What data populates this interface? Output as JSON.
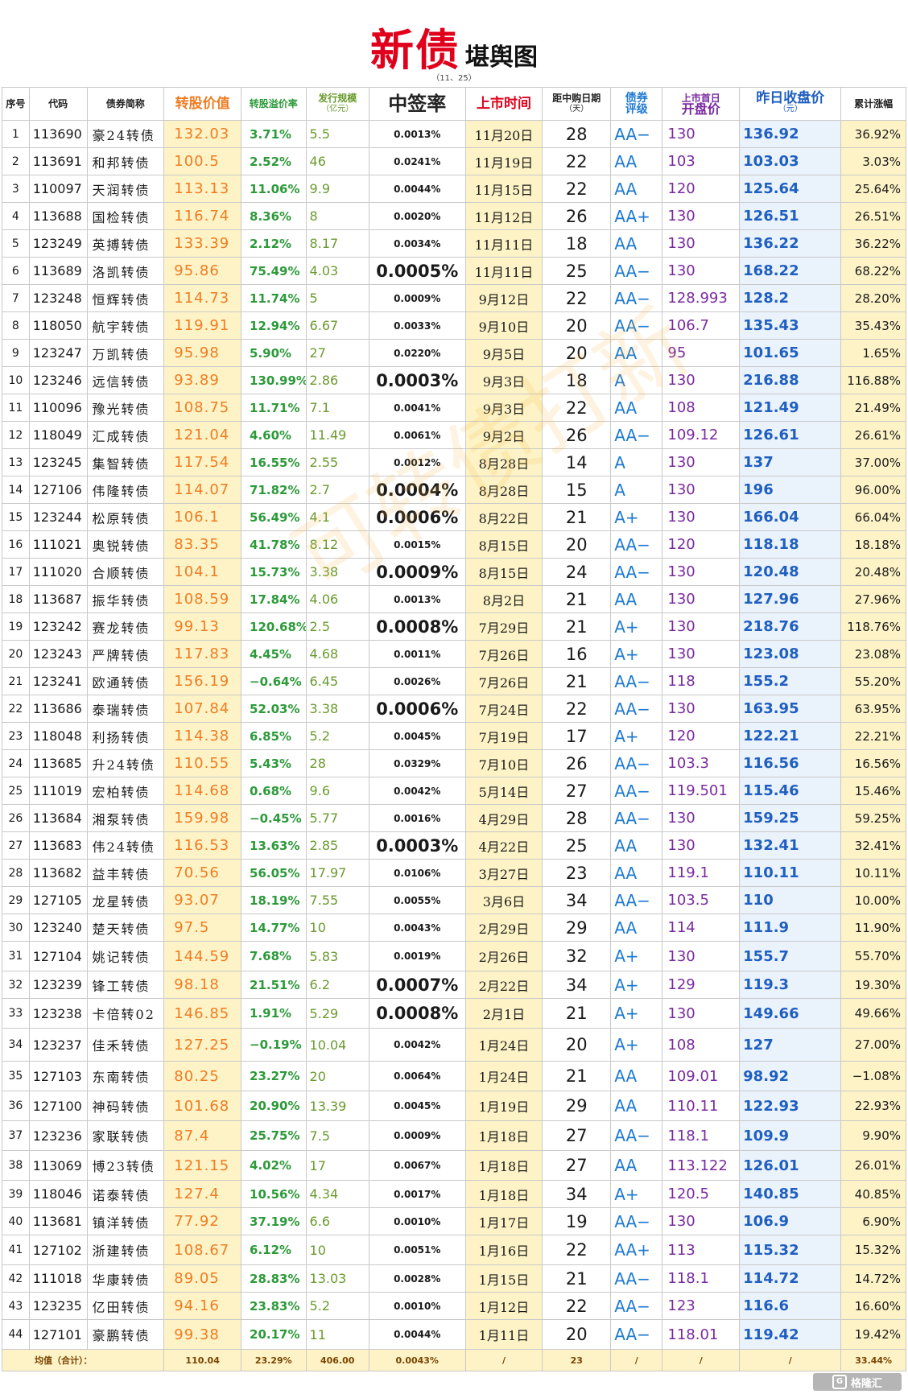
{
  "title": {
    "big": "新债",
    "small": "堪舆图"
  },
  "date": "（11、25）",
  "headers": {
    "no": "序号",
    "code": "代码",
    "name": "债券简称",
    "conv": "转股价值",
    "prem": "转股溢价率",
    "issue_line1": "发行规模",
    "issue_line2": "（亿元）",
    "rate": "中签率",
    "ldate": "上市时间",
    "days_line1": "距中购日期",
    "days_line2": "（天）",
    "grade_line1": "债券",
    "grade_line2": "评级",
    "open_line1": "上市首日",
    "open_line2": "开盘价",
    "close_line1": "昨日收盘价",
    "close_line2": "（元）",
    "cum": "累计涨幅"
  },
  "rows": [
    {
      "no": "1",
      "code": "113690",
      "name": "豪24转债",
      "conv": "132.03",
      "prem": "3.71%",
      "issue": "5.5",
      "rate": "0.0013%",
      "ldate": "11月20日",
      "days": "28",
      "grade": "AA−",
      "open": "130",
      "close": "136.92",
      "cum": "36.92%"
    },
    {
      "no": "2",
      "code": "113691",
      "name": "和邦转债",
      "conv": "100.5",
      "prem": "2.52%",
      "issue": "46",
      "rate": "0.0241%",
      "ldate": "11月19日",
      "days": "22",
      "grade": "AA",
      "open": "103",
      "close": "103.03",
      "cum": "3.03%"
    },
    {
      "no": "3",
      "code": "110097",
      "name": "天润转债",
      "conv": "113.13",
      "prem": "11.06%",
      "issue": "9.9",
      "rate": "0.0044%",
      "ldate": "11月15日",
      "days": "22",
      "grade": "AA",
      "open": "120",
      "close": "125.64",
      "cum": "25.64%"
    },
    {
      "no": "4",
      "code": "113688",
      "name": "国检转债",
      "conv": "116.74",
      "prem": "8.36%",
      "issue": "8",
      "rate": "0.0020%",
      "ldate": "11月12日",
      "days": "26",
      "grade": "AA+",
      "open": "130",
      "close": "126.51",
      "cum": "26.51%"
    },
    {
      "no": "5",
      "code": "123249",
      "name": "英搏转债",
      "conv": "133.39",
      "prem": "2.12%",
      "issue": "8.17",
      "rate": "0.0034%",
      "ldate": "11月11日",
      "days": "18",
      "grade": "AA",
      "open": "130",
      "close": "136.22",
      "cum": "36.22%"
    },
    {
      "no": "6",
      "code": "113689",
      "name": "洛凯转债",
      "conv": "95.86",
      "prem": "75.49%",
      "issue": "4.03",
      "rate": "0.0005%",
      "big": true,
      "ldate": "11月11日",
      "days": "25",
      "grade": "AA−",
      "open": "130",
      "close": "168.22",
      "cum": "68.22%"
    },
    {
      "no": "7",
      "code": "123248",
      "name": "恒辉转债",
      "conv": "114.73",
      "prem": "11.74%",
      "issue": "5",
      "rate": "0.0009%",
      "ldate": "9月12日",
      "days": "22",
      "grade": "AA−",
      "open": "128.993",
      "close": "128.2",
      "cum": "28.20%"
    },
    {
      "no": "8",
      "code": "118050",
      "name": "航宇转债",
      "conv": "119.91",
      "prem": "12.94%",
      "issue": "6.67",
      "rate": "0.0033%",
      "ldate": "9月10日",
      "days": "20",
      "grade": "AA−",
      "open": "106.7",
      "close": "135.43",
      "cum": "35.43%"
    },
    {
      "no": "9",
      "code": "123247",
      "name": "万凯转债",
      "conv": "95.98",
      "prem": "5.90%",
      "issue": "27",
      "rate": "0.0220%",
      "ldate": "9月5日",
      "days": "20",
      "grade": "AA",
      "open": "95",
      "close": "101.65",
      "cum": "1.65%"
    },
    {
      "no": "10",
      "code": "123246",
      "name": "远信转债",
      "conv": "93.89",
      "prem": "130.99%",
      "issue": "2.86",
      "rate": "0.0003%",
      "big": true,
      "ldate": "9月3日",
      "days": "18",
      "grade": "A",
      "open": "130",
      "close": "216.88",
      "cum": "116.88%"
    },
    {
      "no": "11",
      "code": "110096",
      "name": "豫光转债",
      "conv": "108.75",
      "prem": "11.71%",
      "issue": "7.1",
      "rate": "0.0041%",
      "ldate": "9月3日",
      "days": "22",
      "grade": "AA",
      "open": "108",
      "close": "121.49",
      "cum": "21.49%"
    },
    {
      "no": "12",
      "code": "118049",
      "name": "汇成转债",
      "conv": "121.04",
      "prem": "4.60%",
      "issue": "11.49",
      "rate": "0.0061%",
      "ldate": "9月2日",
      "days": "26",
      "grade": "AA−",
      "open": "109.12",
      "close": "126.61",
      "cum": "26.61%"
    },
    {
      "no": "13",
      "code": "123245",
      "name": "集智转债",
      "conv": "117.54",
      "prem": "16.55%",
      "issue": "2.55",
      "rate": "0.0012%",
      "ldate": "8月28日",
      "days": "14",
      "grade": "A",
      "open": "130",
      "close": "137",
      "cum": "37.00%"
    },
    {
      "no": "14",
      "code": "127106",
      "name": "伟隆转债",
      "conv": "114.07",
      "prem": "71.82%",
      "issue": "2.7",
      "rate": "0.0004%",
      "big": true,
      "ldate": "8月28日",
      "days": "15",
      "grade": "A",
      "open": "130",
      "close": "196",
      "cum": "96.00%"
    },
    {
      "no": "15",
      "code": "123244",
      "name": "松原转债",
      "conv": "106.1",
      "prem": "56.49%",
      "issue": "4.1",
      "rate": "0.0006%",
      "big": true,
      "ldate": "8月22日",
      "days": "21",
      "grade": "A+",
      "open": "130",
      "close": "166.04",
      "cum": "66.04%"
    },
    {
      "no": "16",
      "code": "111021",
      "name": "奥锐转债",
      "conv": "83.35",
      "prem": "41.78%",
      "issue": "8.12",
      "rate": "0.0015%",
      "ldate": "8月15日",
      "days": "20",
      "grade": "AA−",
      "open": "120",
      "close": "118.18",
      "cum": "18.18%"
    },
    {
      "no": "17",
      "code": "111020",
      "name": "合顺转债",
      "conv": "104.1",
      "prem": "15.73%",
      "issue": "3.38",
      "rate": "0.0009%",
      "big": true,
      "ldate": "8月15日",
      "days": "24",
      "grade": "AA−",
      "open": "130",
      "close": "120.48",
      "cum": "20.48%"
    },
    {
      "no": "18",
      "code": "113687",
      "name": "振华转债",
      "conv": "108.59",
      "prem": "17.84%",
      "issue": "4.06",
      "rate": "0.0013%",
      "ldate": "8月2日",
      "days": "21",
      "grade": "AA",
      "open": "130",
      "close": "127.96",
      "cum": "27.96%"
    },
    {
      "no": "19",
      "code": "123242",
      "name": "赛龙转债",
      "conv": "99.13",
      "prem": "120.68%",
      "issue": "2.5",
      "rate": "0.0008%",
      "big": true,
      "ldate": "7月29日",
      "days": "21",
      "grade": "A+",
      "open": "130",
      "close": "218.76",
      "cum": "118.76%"
    },
    {
      "no": "20",
      "code": "123243",
      "name": "严牌转债",
      "conv": "117.83",
      "prem": "4.45%",
      "issue": "4.68",
      "rate": "0.0011%",
      "ldate": "7月26日",
      "days": "16",
      "grade": "A+",
      "open": "130",
      "close": "123.08",
      "cum": "23.08%"
    },
    {
      "no": "21",
      "code": "123241",
      "name": "欧通转债",
      "conv": "156.19",
      "prem": "−0.64%",
      "issue": "6.45",
      "rate": "0.0026%",
      "ldate": "7月26日",
      "days": "21",
      "grade": "AA−",
      "open": "118",
      "close": "155.2",
      "cum": "55.20%"
    },
    {
      "no": "22",
      "code": "113686",
      "name": "泰瑞转债",
      "conv": "107.84",
      "prem": "52.03%",
      "issue": "3.38",
      "rate": "0.0006%",
      "big": true,
      "ldate": "7月24日",
      "days": "22",
      "grade": "AA−",
      "open": "130",
      "close": "163.95",
      "cum": "63.95%"
    },
    {
      "no": "23",
      "code": "118048",
      "name": "利扬转债",
      "conv": "114.38",
      "prem": "6.85%",
      "issue": "5.2",
      "rate": "0.0045%",
      "ldate": "7月19日",
      "days": "17",
      "grade": "A+",
      "open": "120",
      "close": "122.21",
      "cum": "22.21%"
    },
    {
      "no": "24",
      "code": "113685",
      "name": "升24转债",
      "conv": "110.55",
      "prem": "5.43%",
      "issue": "28",
      "rate": "0.0329%",
      "ldate": "7月10日",
      "days": "26",
      "grade": "AA−",
      "open": "103.3",
      "close": "116.56",
      "cum": "16.56%"
    },
    {
      "no": "25",
      "code": "111019",
      "name": "宏柏转债",
      "conv": "114.68",
      "prem": "0.68%",
      "issue": "9.6",
      "rate": "0.0042%",
      "ldate": "5月14日",
      "days": "27",
      "grade": "AA−",
      "open": "119.501",
      "close": "115.46",
      "cum": "15.46%"
    },
    {
      "no": "26",
      "code": "113684",
      "name": "湘泵转债",
      "conv": "159.98",
      "prem": "−0.45%",
      "issue": "5.77",
      "rate": "0.0016%",
      "ldate": "4月29日",
      "days": "28",
      "grade": "AA−",
      "open": "130",
      "close": "159.25",
      "cum": "59.25%"
    },
    {
      "no": "27",
      "code": "113683",
      "name": "伟24转债",
      "conv": "116.53",
      "prem": "13.63%",
      "issue": "2.85",
      "rate": "0.0003%",
      "big": true,
      "ldate": "4月22日",
      "days": "25",
      "grade": "AA",
      "open": "130",
      "close": "132.41",
      "cum": "32.41%"
    },
    {
      "no": "28",
      "code": "113682",
      "name": "益丰转债",
      "conv": "70.56",
      "prem": "56.05%",
      "issue": "17.97",
      "rate": "0.0106%",
      "ldate": "3月27日",
      "days": "23",
      "grade": "AA",
      "open": "119.1",
      "close": "110.11",
      "cum": "10.11%"
    },
    {
      "no": "29",
      "code": "127105",
      "name": "龙星转债",
      "conv": "93.07",
      "prem": "18.19%",
      "issue": "7.55",
      "rate": "0.0055%",
      "ldate": "3月6日",
      "days": "34",
      "grade": "AA−",
      "open": "103.5",
      "close": "110",
      "cum": "10.00%"
    },
    {
      "no": "30",
      "code": "123240",
      "name": "楚天转债",
      "conv": "97.5",
      "prem": "14.77%",
      "issue": "10",
      "rate": "0.0043%",
      "ldate": "2月29日",
      "days": "29",
      "grade": "AA",
      "open": "114",
      "close": "111.9",
      "cum": "11.90%"
    },
    {
      "no": "31",
      "code": "127104",
      "name": "姚记转债",
      "conv": "144.59",
      "prem": "7.68%",
      "issue": "5.83",
      "rate": "0.0019%",
      "ldate": "2月26日",
      "days": "32",
      "grade": "A+",
      "open": "130",
      "close": "155.7",
      "cum": "55.70%",
      "tall": true
    },
    {
      "no": "32",
      "code": "123239",
      "name": "锋工转债",
      "conv": "98.18",
      "prem": "21.51%",
      "issue": "6.2",
      "rate": "0.0007%",
      "big": true,
      "ldate": "2月22日",
      "days": "34",
      "grade": "A+",
      "open": "129",
      "close": "119.3",
      "cum": "19.30%"
    },
    {
      "no": "33",
      "code": "123238",
      "name": "卡倍转02",
      "conv": "146.85",
      "prem": "1.91%",
      "issue": "5.29",
      "rate": "0.0008%",
      "big": true,
      "ldate": "2月1日",
      "days": "21",
      "grade": "A+",
      "open": "130",
      "close": "149.66",
      "cum": "49.66%",
      "tall": true
    },
    {
      "no": "34",
      "code": "123237",
      "name": "佳禾转债",
      "conv": "127.25",
      "prem": "−0.19%",
      "issue": "10.04",
      "rate": "0.0042%",
      "ldate": "1月24日",
      "days": "20",
      "grade": "A+",
      "open": "108",
      "close": "127",
      "cum": "27.00%",
      "taller": true
    },
    {
      "no": "35",
      "code": "127103",
      "name": "东南转债",
      "conv": "80.25",
      "prem": "23.27%",
      "issue": "20",
      "rate": "0.0064%",
      "ldate": "1月24日",
      "days": "21",
      "grade": "AA",
      "open": "109.01",
      "close": "98.92",
      "cum": "−1.08%",
      "tall": true
    },
    {
      "no": "36",
      "code": "127100",
      "name": "神码转债",
      "conv": "101.68",
      "prem": "20.90%",
      "issue": "13.39",
      "rate": "0.0045%",
      "ldate": "1月19日",
      "days": "29",
      "grade": "AA",
      "open": "110.11",
      "close": "122.93",
      "cum": "22.93%",
      "tall": true
    },
    {
      "no": "37",
      "code": "123236",
      "name": "家联转债",
      "conv": "87.4",
      "prem": "25.75%",
      "issue": "7.5",
      "rate": "0.0009%",
      "ldate": "1月18日",
      "days": "27",
      "grade": "AA−",
      "open": "118.1",
      "close": "109.9",
      "cum": "9.90%",
      "tall": true
    },
    {
      "no": "38",
      "code": "113069",
      "name": "博23转债",
      "conv": "121.15",
      "prem": "4.02%",
      "issue": "17",
      "rate": "0.0067%",
      "ldate": "1月18日",
      "days": "27",
      "grade": "AA",
      "open": "113.122",
      "close": "126.01",
      "cum": "26.01%",
      "tall": true
    },
    {
      "no": "39",
      "code": "118046",
      "name": "诺泰转债",
      "conv": "127.4",
      "prem": "10.56%",
      "issue": "4.34",
      "rate": "0.0017%",
      "ldate": "1月18日",
      "days": "34",
      "grade": "A+",
      "open": "120.5",
      "close": "140.85",
      "cum": "40.85%"
    },
    {
      "no": "40",
      "code": "113681",
      "name": "镇洋转债",
      "conv": "77.92",
      "prem": "37.19%",
      "issue": "6.6",
      "rate": "0.0010%",
      "ldate": "1月17日",
      "days": "19",
      "grade": "AA−",
      "open": "130",
      "close": "106.9",
      "cum": "6.90%"
    },
    {
      "no": "41",
      "code": "127102",
      "name": "浙建转债",
      "conv": "108.67",
      "prem": "6.12%",
      "issue": "10",
      "rate": "0.0051%",
      "ldate": "1月16日",
      "days": "22",
      "grade": "AA+",
      "open": "113",
      "close": "115.32",
      "cum": "15.32%",
      "tall": true
    },
    {
      "no": "42",
      "code": "111018",
      "name": "华康转债",
      "conv": "89.05",
      "prem": "28.83%",
      "issue": "13.03",
      "rate": "0.0028%",
      "ldate": "1月15日",
      "days": "21",
      "grade": "AA−",
      "open": "118.1",
      "close": "114.72",
      "cum": "14.72%"
    },
    {
      "no": "43",
      "code": "123235",
      "name": "亿田转债",
      "conv": "94.16",
      "prem": "23.83%",
      "issue": "5.2",
      "rate": "0.0010%",
      "ldate": "1月12日",
      "days": "22",
      "grade": "AA−",
      "open": "123",
      "close": "116.6",
      "cum": "16.60%"
    },
    {
      "no": "44",
      "code": "127101",
      "name": "豪鹏转债",
      "conv": "99.38",
      "prem": "20.17%",
      "issue": "11",
      "rate": "0.0044%",
      "ldate": "1月11日",
      "days": "20",
      "grade": "AA−",
      "open": "118.01",
      "close": "119.42",
      "cum": "19.42%",
      "tall": true
    }
  ],
  "footer": {
    "label": "均值（合计）：",
    "conv": "110.04",
    "prem": "23.29%",
    "issue": "406.00",
    "rate": "0.0043%",
    "ldate": "/",
    "days": "23",
    "grade": "/",
    "open": "/",
    "close": "/",
    "cum": "33.44%"
  },
  "watermark": "可转债打新",
  "logo": "格隆汇",
  "colors": {
    "title_red": "#e0001b",
    "orange": "#f07c22",
    "green": "#2d9a3a",
    "blue": "#1f7ad1",
    "purple": "#7a2aa0",
    "cream": "#fdf3c6"
  }
}
